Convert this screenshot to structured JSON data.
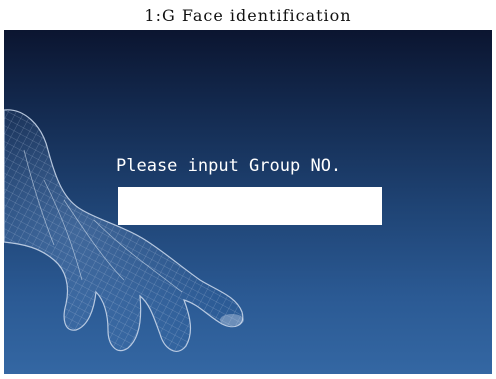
{
  "window": {
    "title": "1:G Face identification"
  },
  "screen": {
    "prompt_label": "Please input Group NO.",
    "group_input_value": "",
    "background_image": "wireframe-hand-icon"
  },
  "colors": {
    "background_top": "#0b1530",
    "background_bottom": "#3467a3",
    "prompt_text": "#ffffff",
    "input_background": "#ffffff"
  }
}
